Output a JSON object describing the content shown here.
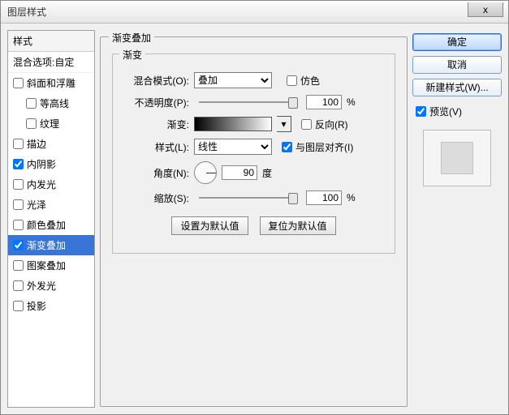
{
  "title": "图层样式",
  "left": {
    "header": "样式",
    "blend_opts": "混合选项:自定",
    "items": [
      {
        "label": "斜面和浮雕",
        "checked": false,
        "selected": false,
        "indent": false
      },
      {
        "label": "等高线",
        "checked": false,
        "selected": false,
        "indent": true
      },
      {
        "label": "纹理",
        "checked": false,
        "selected": false,
        "indent": true
      },
      {
        "label": "描边",
        "checked": false,
        "selected": false,
        "indent": false
      },
      {
        "label": "内阴影",
        "checked": true,
        "selected": false,
        "indent": false
      },
      {
        "label": "内发光",
        "checked": false,
        "selected": false,
        "indent": false
      },
      {
        "label": "光泽",
        "checked": false,
        "selected": false,
        "indent": false
      },
      {
        "label": "颜色叠加",
        "checked": false,
        "selected": false,
        "indent": false
      },
      {
        "label": "渐变叠加",
        "checked": true,
        "selected": true,
        "indent": false
      },
      {
        "label": "图案叠加",
        "checked": false,
        "selected": false,
        "indent": false
      },
      {
        "label": "外发光",
        "checked": false,
        "selected": false,
        "indent": false
      },
      {
        "label": "投影",
        "checked": false,
        "selected": false,
        "indent": false
      }
    ]
  },
  "mid": {
    "group_title": "渐变叠加",
    "inner_title": "渐变",
    "blend_mode_label": "混合模式(O):",
    "blend_mode_value": "叠加",
    "dither_label": "仿色",
    "dither_checked": false,
    "opacity_label": "不透明度(P):",
    "opacity_value": "100",
    "opacity_pct": "%",
    "gradient_label": "渐变:",
    "reverse_label": "反向(R)",
    "reverse_checked": false,
    "style_label": "样式(L):",
    "style_value": "线性",
    "align_label": "与图层对齐(I)",
    "align_checked": true,
    "angle_label": "角度(N):",
    "angle_value": "90",
    "angle_unit": "度",
    "scale_label": "缩放(S):",
    "scale_value": "100",
    "scale_pct": "%",
    "set_default": "设置为默认值",
    "reset_default": "复位为默认值"
  },
  "right": {
    "ok": "确定",
    "cancel": "取消",
    "new_style": "新建样式(W)...",
    "preview_label": "预览(V)",
    "preview_checked": true
  }
}
